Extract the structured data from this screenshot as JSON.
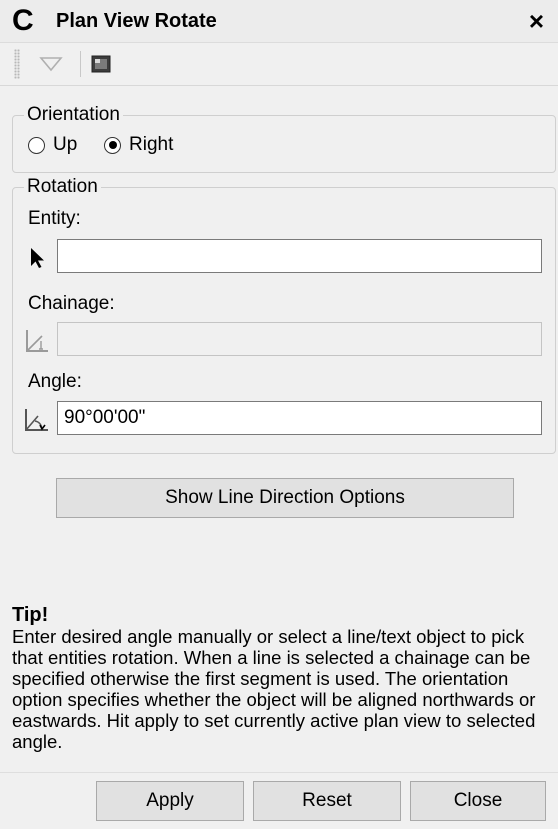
{
  "titlebar": {
    "logo": "C",
    "title": "Plan View Rotate",
    "close": "×"
  },
  "orientation": {
    "legend": "Orientation",
    "options": [
      "Up",
      "Right"
    ],
    "selected": "Right"
  },
  "rotation": {
    "legend": "Rotation",
    "entity_label": "Entity:",
    "entity_value": "",
    "chainage_label": "Chainage:",
    "chainage_value": "",
    "angle_label": "Angle:",
    "angle_value": "90°00'00\""
  },
  "show_line_direction_label": "Show Line Direction Options",
  "tip": {
    "title": "Tip!",
    "text": "Enter desired angle manually or select a line/text object to pick that entities rotation. When a line is selected a chainage can be specified otherwise the first segment is used. The orientation option specifies whether the object will be aligned northwards or eastwards. Hit apply to set currently active plan view to selected angle."
  },
  "buttons": {
    "apply": "Apply",
    "reset": "Reset",
    "close": "Close"
  },
  "icons": {
    "toolbar": [
      "dropdown-triangle-icon",
      "panel-icon"
    ],
    "entity": "cursor-arrow-icon",
    "chainage": "chainage-icon",
    "angle": "angle-icon"
  }
}
